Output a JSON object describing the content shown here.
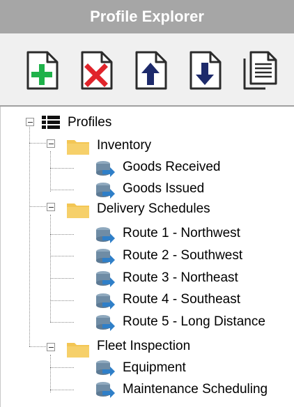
{
  "panel": {
    "title": "Profile Explorer"
  },
  "toolbar": {
    "buttons": [
      {
        "name": "add-profile-button",
        "icon": "document-add-icon"
      },
      {
        "name": "delete-profile-button",
        "icon": "document-delete-icon"
      },
      {
        "name": "move-up-button",
        "icon": "document-up-icon"
      },
      {
        "name": "move-down-button",
        "icon": "document-down-icon"
      },
      {
        "name": "copy-profile-button",
        "icon": "document-copy-icon"
      }
    ]
  },
  "tree": {
    "root": {
      "label": "Profiles",
      "icon": "list-icon",
      "expanded": true,
      "groups": [
        {
          "label": "Inventory",
          "icon": "folder-icon",
          "expanded": true,
          "items": [
            {
              "label": "Goods Received"
            },
            {
              "label": "Goods Issued"
            }
          ]
        },
        {
          "label": "Delivery Schedules",
          "icon": "folder-icon",
          "expanded": true,
          "items": [
            {
              "label": "Route 1 - Northwest"
            },
            {
              "label": "Route 2 - Southwest"
            },
            {
              "label": "Route 3 - Northeast"
            },
            {
              "label": "Route 4 - Southeast"
            },
            {
              "label": "Route 5 - Long Distance"
            }
          ]
        },
        {
          "label": "Fleet Inspection",
          "icon": "folder-icon",
          "expanded": true,
          "items": [
            {
              "label": "Equipment"
            },
            {
              "label": "Maintenance Scheduling"
            }
          ]
        }
      ]
    }
  },
  "colors": {
    "title_bar": "#a6a6a6",
    "toolbar": "#f0f0f0",
    "add_green": "#1fb24a",
    "delete_red": "#e0242b",
    "arrow_navy": "#1d2a6b",
    "folder_yellow": "#f3c654"
  }
}
